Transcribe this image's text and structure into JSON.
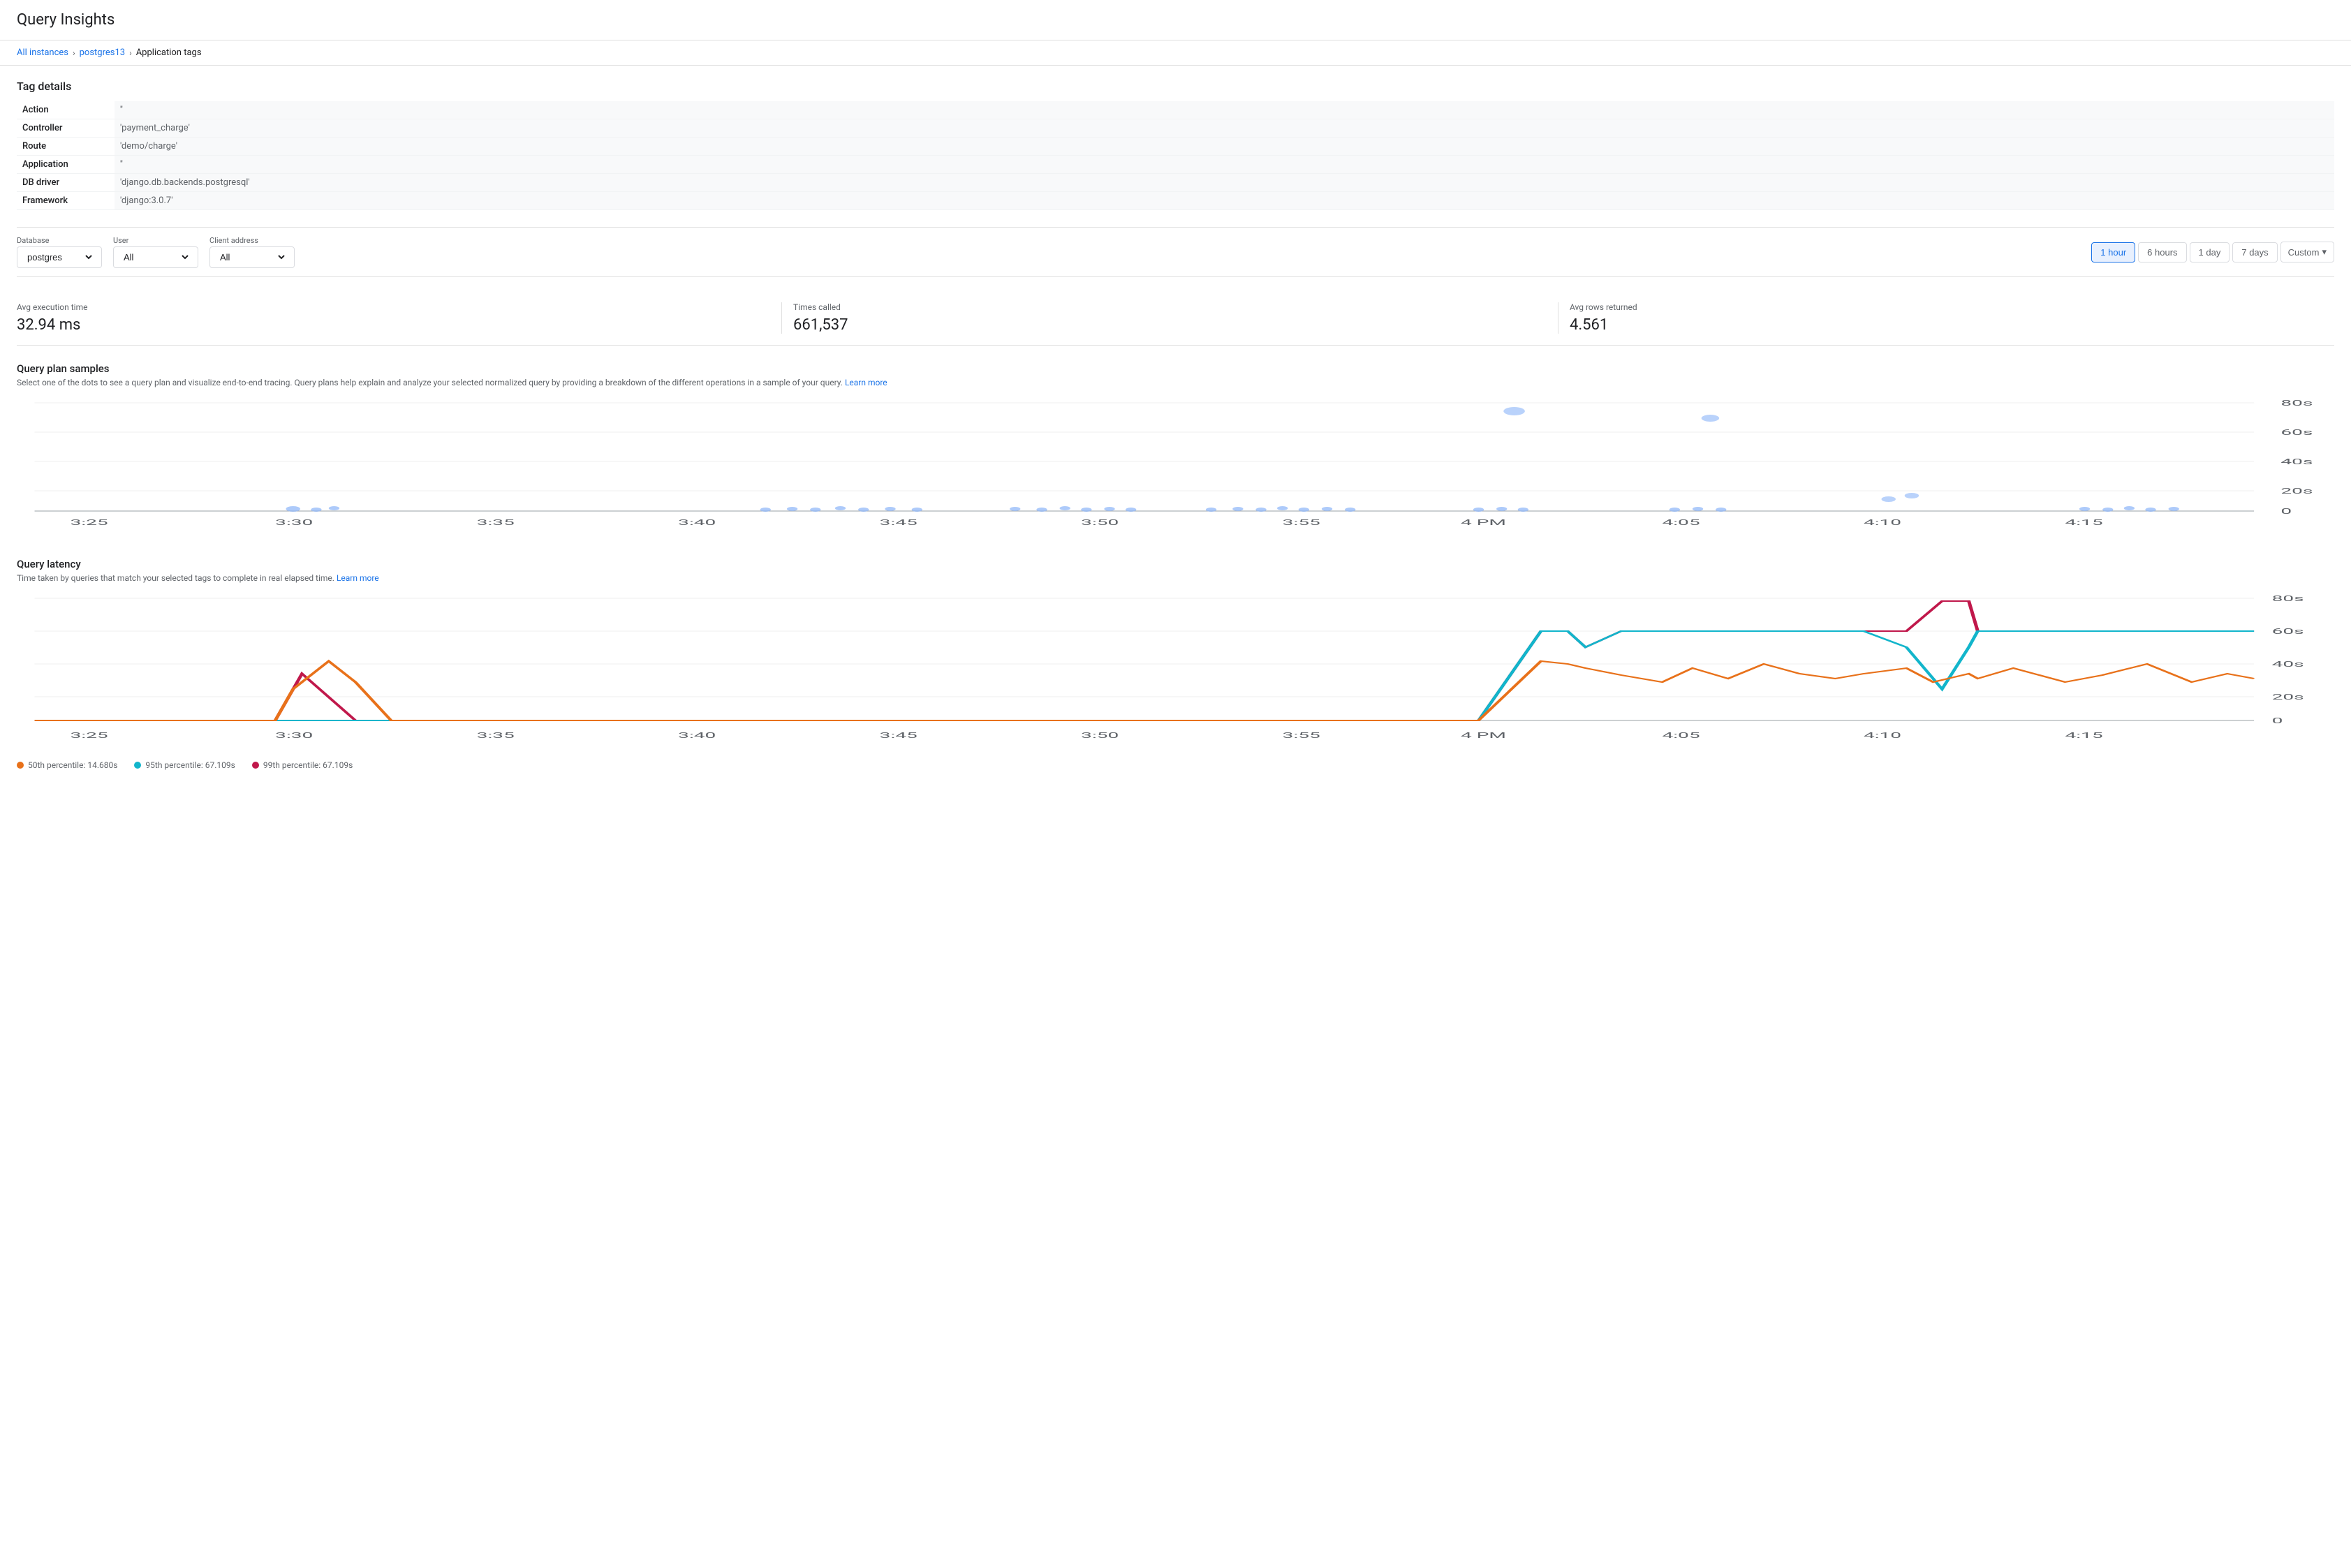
{
  "page": {
    "title": "Query Insights"
  },
  "breadcrumb": {
    "items": [
      {
        "label": "All instances",
        "link": true
      },
      {
        "label": "postgres13",
        "link": true
      },
      {
        "label": "Application tags",
        "link": false
      }
    ]
  },
  "tagDetails": {
    "sectionTitle": "Tag details",
    "rows": [
      {
        "label": "Action",
        "value": "''"
      },
      {
        "label": "Controller",
        "value": "'payment_charge'"
      },
      {
        "label": "Route",
        "value": "'demo/charge'"
      },
      {
        "label": "Application",
        "value": "''"
      },
      {
        "label": "DB driver",
        "value": "'django.db.backends.postgresql'"
      },
      {
        "label": "Framework",
        "value": "'django:3.0.7'"
      }
    ]
  },
  "filters": {
    "database": {
      "label": "Database",
      "value": "postgres",
      "options": [
        "postgres"
      ]
    },
    "user": {
      "label": "User",
      "value": "All",
      "options": [
        "All"
      ]
    },
    "clientAddress": {
      "label": "Client address",
      "value": "All",
      "options": [
        "All"
      ]
    }
  },
  "timeButtons": [
    {
      "label": "1 hour",
      "active": true
    },
    {
      "label": "6 hours",
      "active": false
    },
    {
      "label": "1 day",
      "active": false
    },
    {
      "label": "7 days",
      "active": false
    }
  ],
  "customButton": "Custom",
  "metrics": [
    {
      "label": "Avg execution time",
      "value": "32.94 ms"
    },
    {
      "label": "Times called",
      "value": "661,537"
    },
    {
      "label": "Avg rows returned",
      "value": "4.561"
    }
  ],
  "queryPlanSection": {
    "title": "Query plan samples",
    "description": "Select one of the dots to see a query plan and visualize end-to-end tracing. Query plans help explain and analyze your selected normalized query by providing a breakdown of the different operations in a sample of your query.",
    "learnMore": "Learn more",
    "yAxisLabels": [
      "80s",
      "60s",
      "40s",
      "20s",
      "0"
    ],
    "xAxisLabels": [
      "3:25",
      "3:30",
      "3:35",
      "3:40",
      "3:45",
      "3:50",
      "3:55",
      "4 PM",
      "4:05",
      "4:10",
      "4:15"
    ]
  },
  "queryLatencySection": {
    "title": "Query latency",
    "description": "Time taken by queries that match your selected tags to complete in real elapsed time.",
    "learnMore": "Learn more",
    "yAxisLabels": [
      "80s",
      "60s",
      "40s",
      "20s",
      "0"
    ],
    "xAxisLabels": [
      "3:25",
      "3:30",
      "3:35",
      "3:40",
      "3:45",
      "3:50",
      "3:55",
      "4 PM",
      "4:05",
      "4:10",
      "4:15"
    ],
    "legend": [
      {
        "label": "50th percentile: 14.680s",
        "color": "#e8711a"
      },
      {
        "label": "95th percentile: 67.109s",
        "color": "#12b5cb"
      },
      {
        "label": "99th percentile: 67.109s",
        "color": "#c0184b"
      }
    ]
  }
}
